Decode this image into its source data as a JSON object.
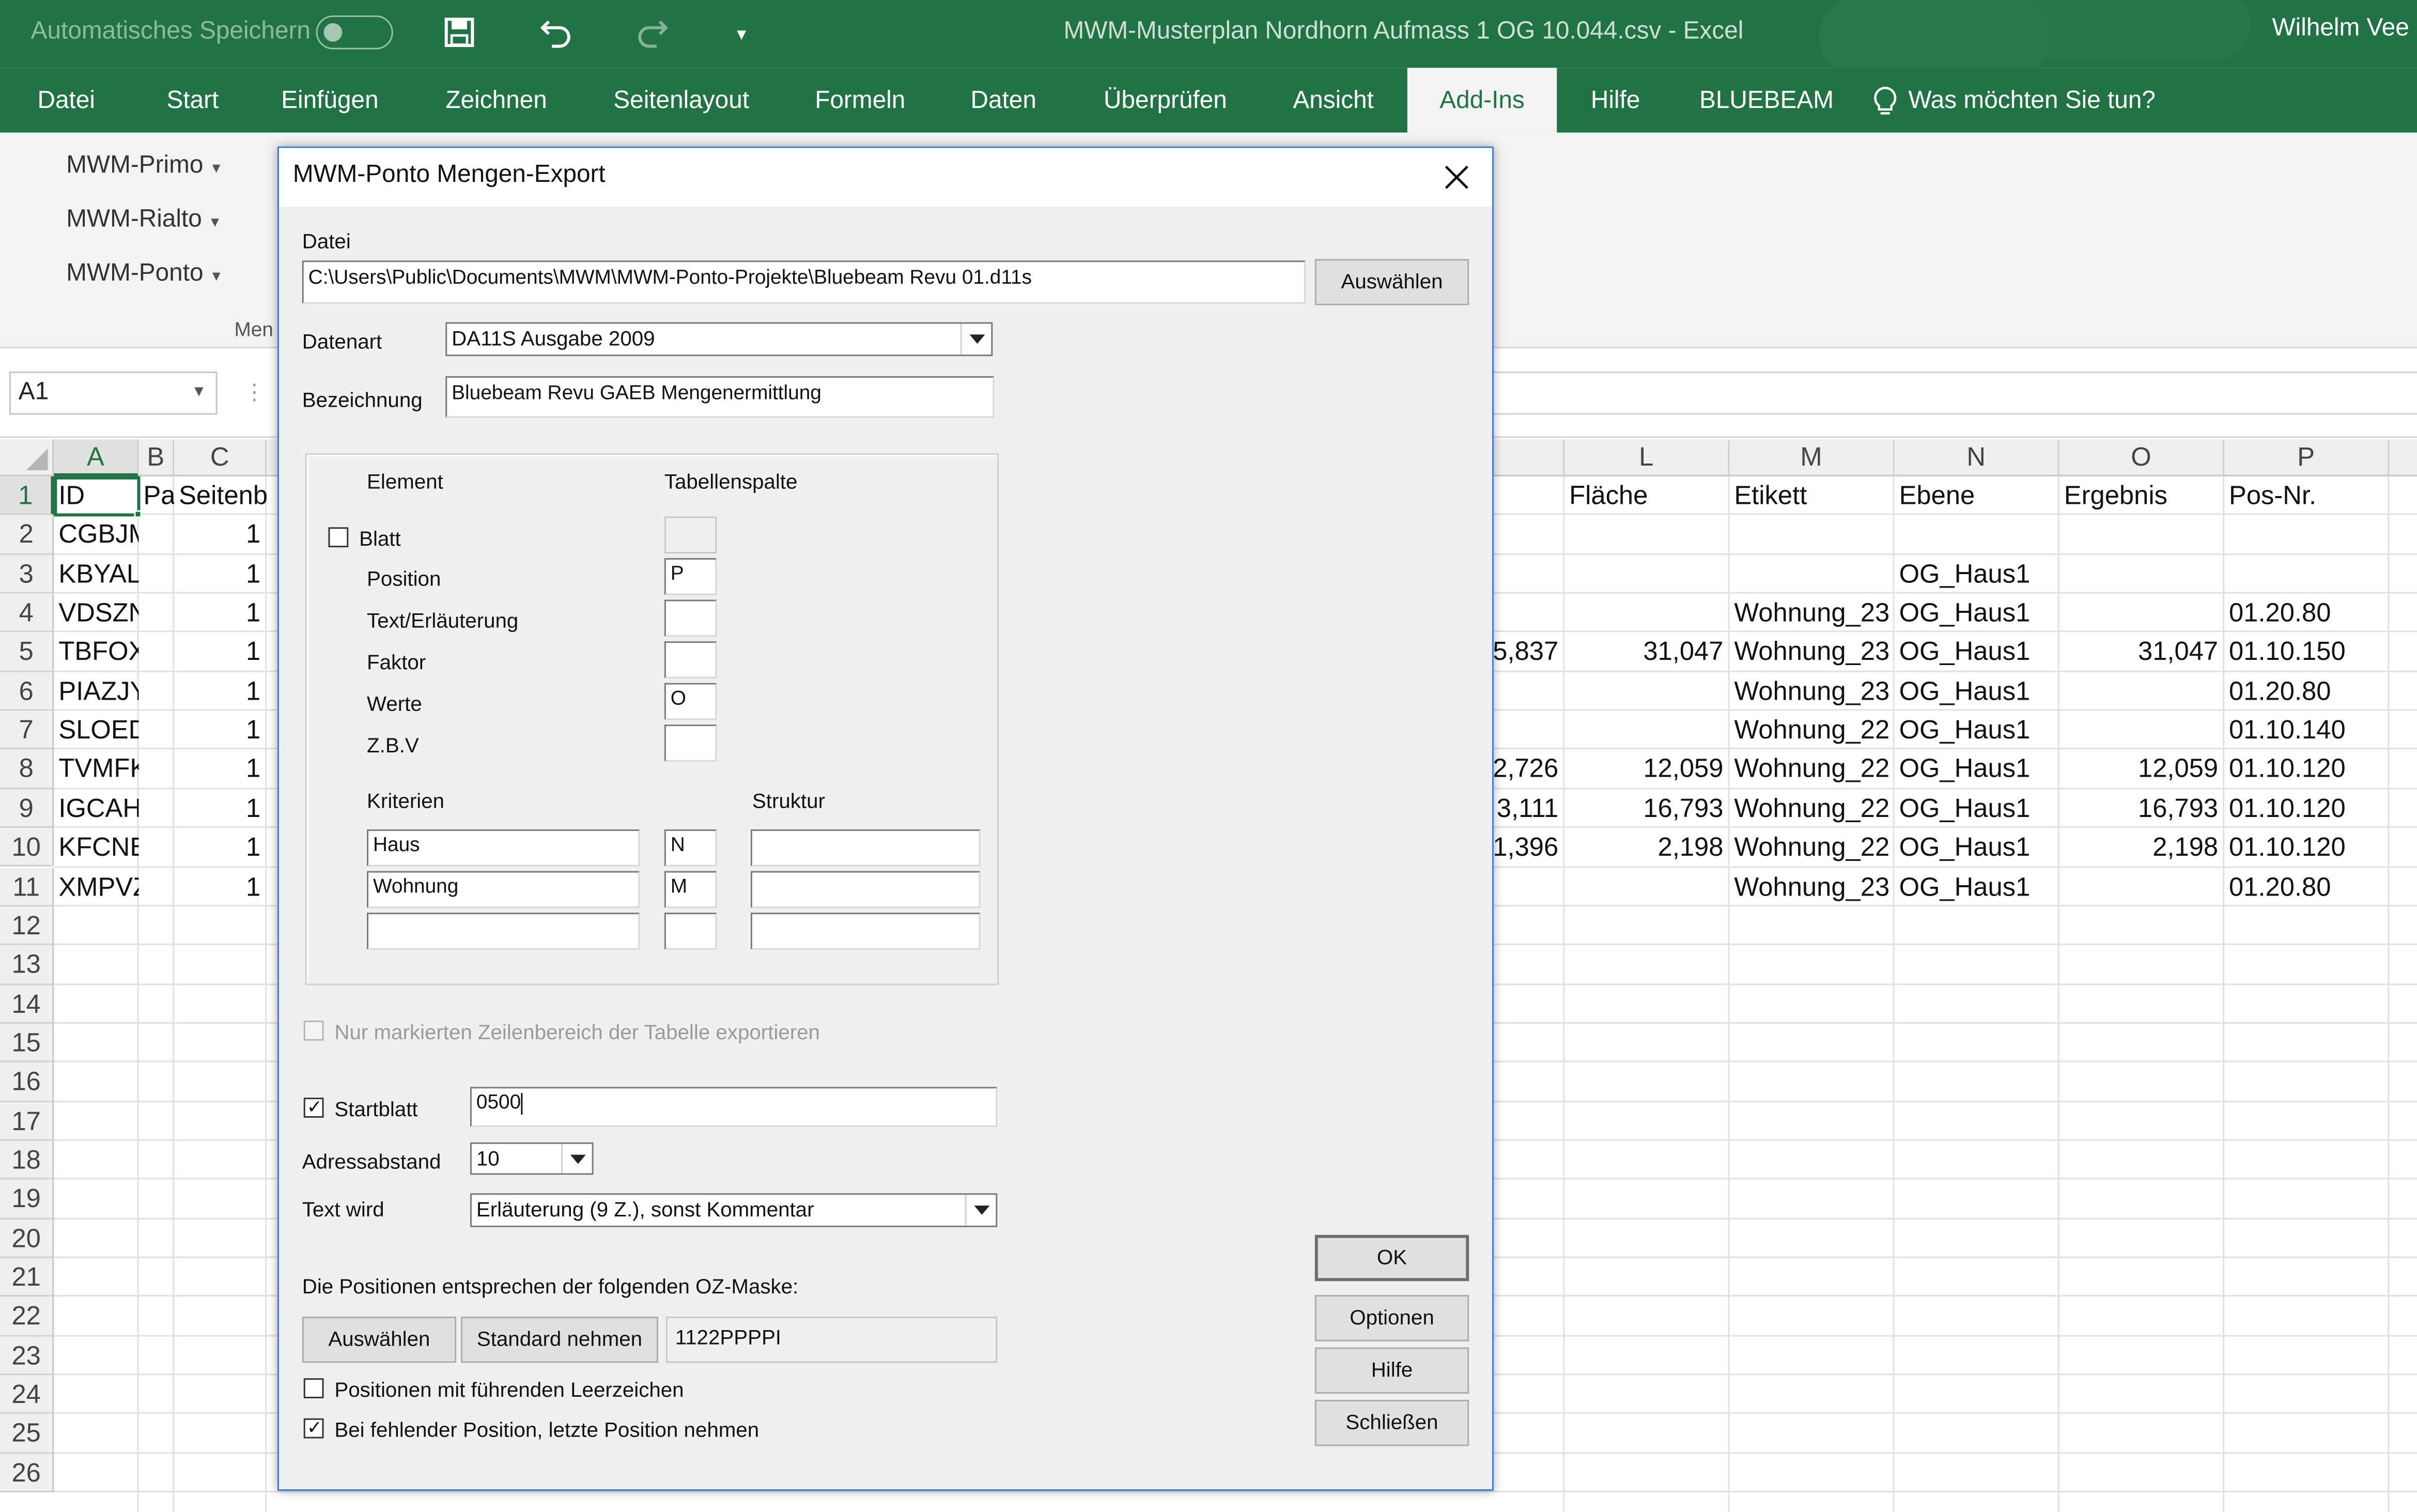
{
  "titlebar": {
    "autosave_label": "Automatisches Speichern",
    "document_title": "MWM-Musterplan Nordhorn Aufmass 1 OG 10.044.csv  -  Excel",
    "user": "Wilhelm Vee"
  },
  "ribbon_tabs": [
    "Datei",
    "Start",
    "Einfügen",
    "Zeichnen",
    "Seitenlayout",
    "Formeln",
    "Daten",
    "Überprüfen",
    "Ansicht",
    "Add-Ins",
    "Hilfe",
    "BLUEBEAM",
    "Was möchten Sie tun?"
  ],
  "ribbon": {
    "buttons": [
      "MWM-Primo",
      "MWM-Rialto",
      "MWM-Ponto"
    ],
    "group_label": "Men"
  },
  "namebox": "A1",
  "grid": {
    "col_headers": [
      "A",
      "B",
      "C",
      "",
      "L",
      "M",
      "N",
      "O",
      "P"
    ],
    "row_numbers": [
      "1",
      "2",
      "3",
      "4",
      "5",
      "6",
      "7",
      "8",
      "9",
      "10",
      "11",
      "12",
      "13",
      "14",
      "15",
      "16",
      "17",
      "18",
      "19",
      "20",
      "21",
      "22",
      "23",
      "24",
      "25",
      "26"
    ],
    "rows": [
      [
        "ID",
        "Pa",
        "Seitenb",
        "",
        "Fläche",
        "Etikett",
        "Ebene",
        "Ergebnis",
        "Pos-Nr."
      ],
      [
        "CGBJMM",
        "",
        "1",
        "",
        "",
        "",
        "",
        "",
        ""
      ],
      [
        "KBYALIDE",
        "",
        "1",
        "",
        "",
        "",
        "OG_Haus1",
        "",
        ""
      ],
      [
        "VDSZNUE",
        "",
        "1",
        "",
        "",
        "Wohnung_23",
        "OG_Haus1",
        "",
        "01.20.80"
      ],
      [
        "TBFOXZW",
        "",
        "1",
        "5,837",
        "31,047",
        "Wohnung_23",
        "OG_Haus1",
        "31,047",
        "01.10.150"
      ],
      [
        "PIAZJYQV",
        "",
        "1",
        "",
        "",
        "Wohnung_23",
        "OG_Haus1",
        "",
        "01.20.80"
      ],
      [
        "SLOEDOB",
        "",
        "1",
        "",
        "",
        "Wohnung_22",
        "OG_Haus1",
        "",
        "01.10.140"
      ],
      [
        "TVMFKYY",
        "",
        "1",
        "2,726",
        "12,059",
        "Wohnung_22",
        "OG_Haus1",
        "12,059",
        "01.10.120"
      ],
      [
        "IGCAHRTI",
        "",
        "1",
        "3,111",
        "16,793",
        "Wohnung_22",
        "OG_Haus1",
        "16,793",
        "01.10.120"
      ],
      [
        "KFCNBAL",
        "",
        "1",
        "1,396",
        "2,198",
        "Wohnung_22",
        "OG_Haus1",
        "2,198",
        "01.10.120"
      ],
      [
        "XMPVZZX",
        "",
        "1",
        "",
        "",
        "Wohnung_23",
        "OG_Haus1",
        "",
        "01.20.80"
      ]
    ]
  },
  "dialog": {
    "title": "MWM-Ponto  Mengen-Export",
    "datei_label": "Datei",
    "datei_value": "C:\\Users\\Public\\Documents\\MWM\\MWM-Ponto-Projekte\\Bluebeam Revu 01.d11s",
    "auswaehlen": "Auswählen",
    "datenart_label": "Datenart",
    "datenart_value": "DA11S Ausgabe 2009",
    "bezeichnung_label": "Bezeichnung",
    "bezeichnung_value": "Bluebeam Revu GAEB Mengenermittlung",
    "element_header": "Element",
    "tabellenspalte_header": "Tabellenspalte",
    "elements": [
      {
        "label": "Blatt",
        "value": ""
      },
      {
        "label": "Position",
        "value": "P"
      },
      {
        "label": "Text/Erläuterung",
        "value": ""
      },
      {
        "label": "Faktor",
        "value": ""
      },
      {
        "label": "Werte",
        "value": "O"
      },
      {
        "label": "Z.B.V",
        "value": ""
      }
    ],
    "kriterien_label": "Kriterien",
    "struktur_label": "Struktur",
    "kriterien": [
      {
        "name": "Haus",
        "col": "N",
        "struktur": ""
      },
      {
        "name": "Wohnung",
        "col": "M",
        "struktur": ""
      },
      {
        "name": "",
        "col": "",
        "struktur": ""
      }
    ],
    "nur_markierten": "Nur markierten Zeilenbereich der Tabelle exportieren",
    "startblatt_label": "Startblatt",
    "startblatt_value": "0500",
    "adressabstand_label": "Adressabstand",
    "adressabstand_value": "10",
    "text_wird_label": "Text wird",
    "text_wird_value": "Erläuterung (9 Z.), sonst Kommentar",
    "oz_maske_label": "Die Positionen entsprechen der folgenden OZ-Maske:",
    "oz_auswaehlen": "Auswählen",
    "standard_nehmen": "Standard nehmen",
    "oz_maske_value": "1122PPPPI",
    "fuehrende_leerzeichen": "Positionen mit führenden Leerzeichen",
    "letzte_position": "Bei fehlender Position, letzte Position nehmen",
    "ok": "OK",
    "optionen": "Optionen",
    "hilfe": "Hilfe",
    "schliessen": "Schließen"
  }
}
